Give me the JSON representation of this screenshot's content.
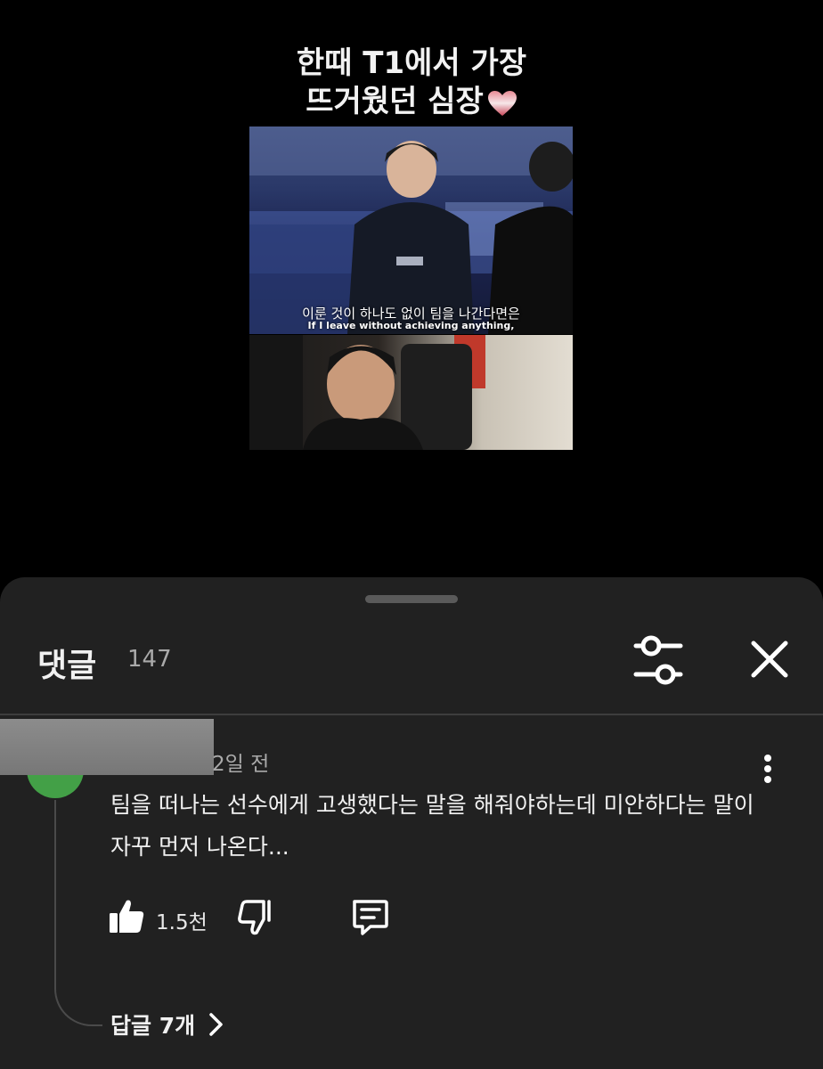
{
  "video": {
    "title_line1": "한때 T1에서 가장",
    "title_line2": "뜨거웠던 심장",
    "subtitle_ko": "이룬 것이 하나도 없이 팀을 나간다면은",
    "subtitle_en": "If I leave without achieving anything,"
  },
  "comments": {
    "title": "댓글",
    "count": "147",
    "comment": {
      "timestamp": "2일 전",
      "text": "팀을 떠나는 선수에게 고생했다는 말을 해줘야하는데 미안하다는 말이 자꾸 먼저 나온다...",
      "likes": "1.5천",
      "replies_label": "답글 7개"
    }
  },
  "icons": {
    "heart": "heart-icon",
    "filter": "sliders-icon",
    "close": "close-icon",
    "more": "more-vert-icon",
    "like": "thumb-up-icon",
    "dislike": "thumb-down-icon",
    "reply": "comment-icon",
    "chevron": "chevron-right-icon"
  },
  "colors": {
    "sheet_bg": "#212121",
    "avatar": "#43a047",
    "secondary_text": "#aaaaaa"
  }
}
